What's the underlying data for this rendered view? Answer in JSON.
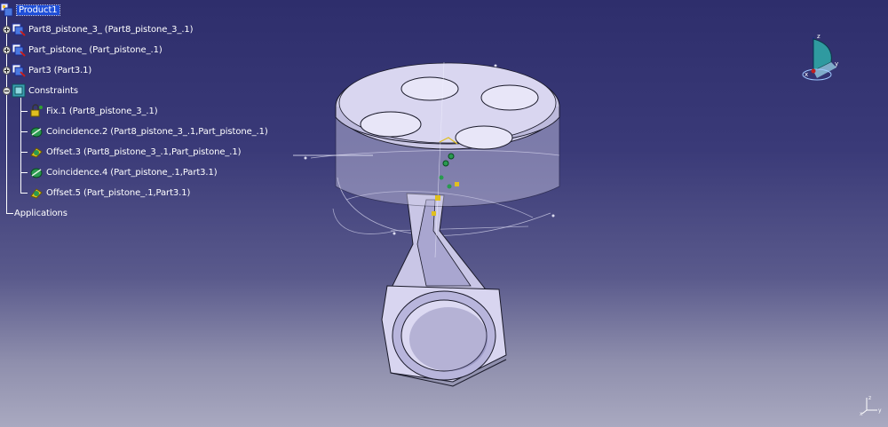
{
  "tree": {
    "root": {
      "label": "Product1"
    },
    "items": [
      {
        "label": "Part8_pistone_3_ (Part8_pistone_3_.1)"
      },
      {
        "label": "Part_pistone_ (Part_pistone_.1)"
      },
      {
        "label": "Part3 (Part3.1)"
      },
      {
        "label": "Constraints"
      }
    ],
    "constraints": [
      {
        "label": "Fix.1 (Part8_pistone_3_.1)"
      },
      {
        "label": "Coincidence.2 (Part8_pistone_3_.1,Part_pistone_.1)"
      },
      {
        "label": "Offset.3 (Part8_pistone_3_.1,Part_pistone_.1)"
      },
      {
        "label": "Coincidence.4 (Part_pistone_.1,Part3.1)"
      },
      {
        "label": "Offset.5 (Part_pistone_.1,Part3.1)"
      }
    ],
    "applications": {
      "label": "Applications"
    }
  },
  "compass": {
    "x": "x",
    "y": "y",
    "z": "z"
  },
  "mini_axis": {
    "x": "x",
    "y": "y",
    "z": "z"
  },
  "colors": {
    "selection": "#1f4fd8",
    "background_top": "#2e2e6c",
    "background_bottom": "#a9a9c0",
    "part_face": "#d6d3ee",
    "part_edge": "#1a1a2a"
  }
}
